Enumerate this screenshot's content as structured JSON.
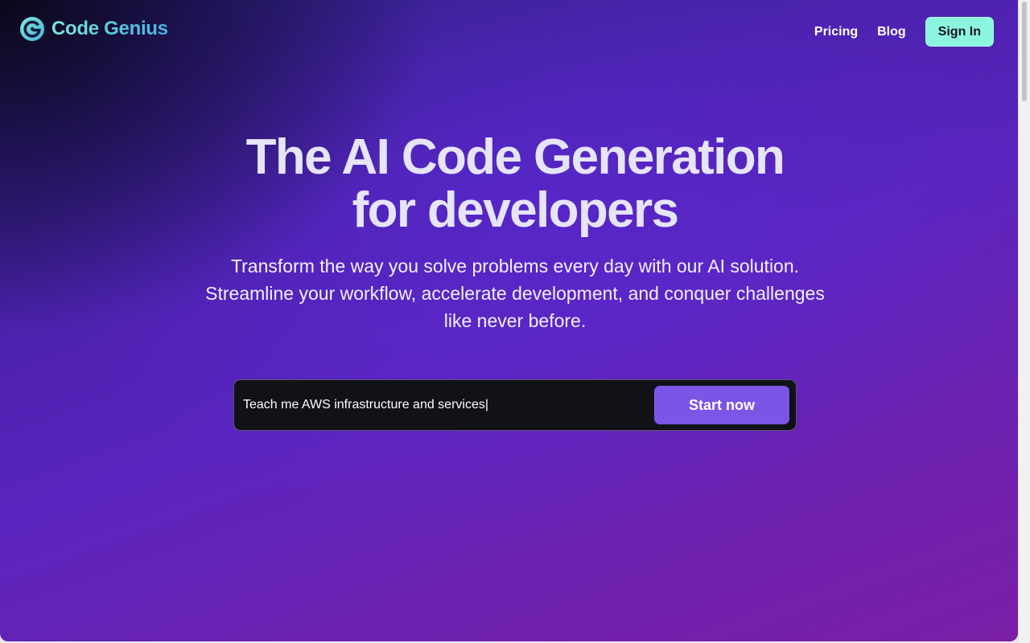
{
  "brand": {
    "name": "Code Genius",
    "logo_icon": "g-circle-logo-icon",
    "colors": {
      "logo_gradient_start": "#7ee8d8",
      "logo_gradient_end": "#4bb3e0"
    }
  },
  "nav": {
    "links": [
      {
        "label": "Pricing"
      },
      {
        "label": "Blog"
      }
    ],
    "signin_label": "Sign In",
    "signin_color": "#8cf5df"
  },
  "hero": {
    "title_lines": [
      "The AI Code Generation",
      "for developers"
    ],
    "subtitle_lines": [
      "Transform the way you solve problems every day with our AI solution.",
      "Streamline your workflow, accelerate development, and conquer challenges",
      "like never before."
    ]
  },
  "prompt": {
    "value": "Teach me AWS infrastructure and services|",
    "button_label": "Start now",
    "button_color": "#7b55e6"
  }
}
